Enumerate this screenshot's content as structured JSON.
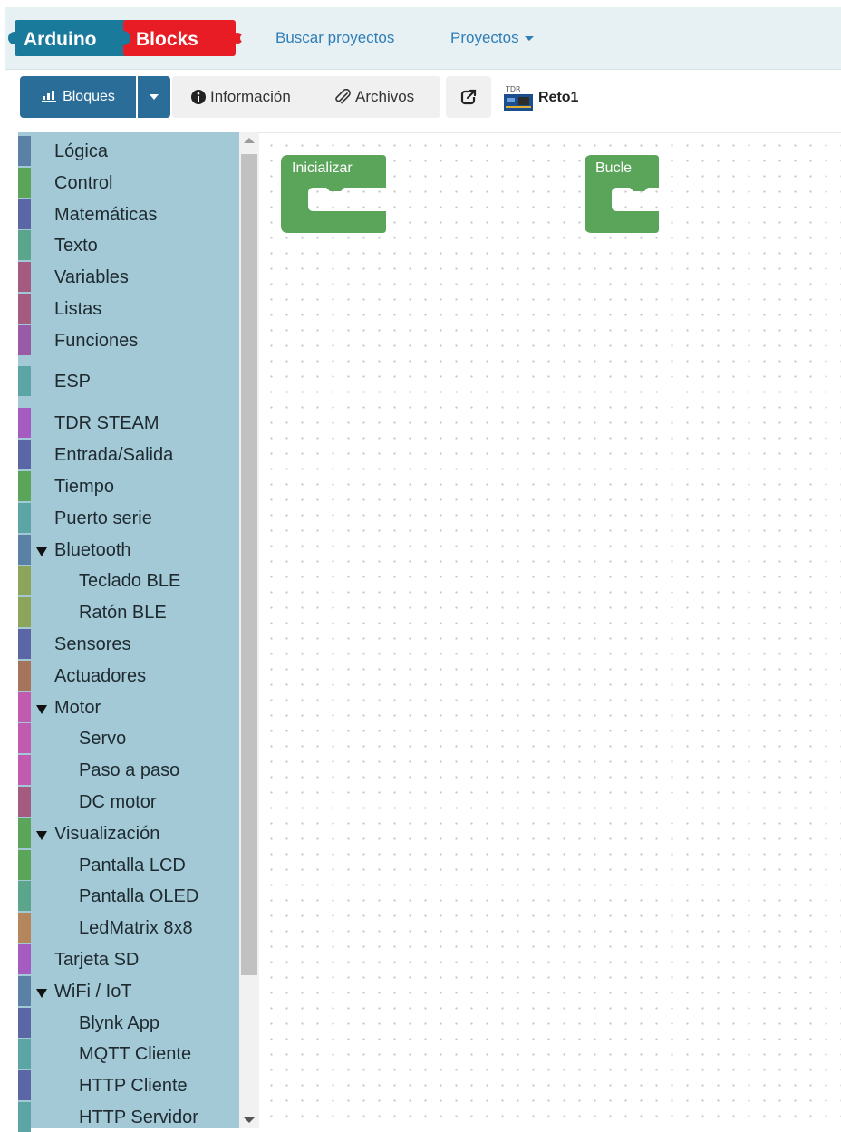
{
  "brand": {
    "part1": "Arduino",
    "part2": "Blocks",
    "color1": "#1a7a9c",
    "color2": "#e81c24"
  },
  "nav": {
    "search_label": "Buscar proyectos",
    "projects_label": "Proyectos"
  },
  "toolbar": {
    "bloques_label": "Bloques",
    "info_label": "Información",
    "files_label": "Archivos",
    "project_name": "Reto1"
  },
  "sidebar": {
    "categories": [
      {
        "label": "Lógica",
        "color": "#5b80a5",
        "level": 0
      },
      {
        "label": "Control",
        "color": "#5ba55b",
        "level": 0
      },
      {
        "label": "Matemáticas",
        "color": "#5b67a5",
        "level": 0
      },
      {
        "label": "Texto",
        "color": "#5ba58c",
        "level": 0
      },
      {
        "label": "Variables",
        "color": "#a55b80",
        "level": 0
      },
      {
        "label": "Listas",
        "color": "#a55b80",
        "level": 0
      },
      {
        "label": "Funciones",
        "color": "#995ba5",
        "level": 0
      },
      {
        "label": "ESP",
        "color": "#5ba5a5",
        "level": 0
      },
      {
        "label": "TDR STEAM",
        "color": "#a55bc0",
        "level": 0
      },
      {
        "label": "Entrada/Salida",
        "color": "#5b67a5",
        "level": 0
      },
      {
        "label": "Tiempo",
        "color": "#5ba55b",
        "level": 0
      },
      {
        "label": "Puerto serie",
        "color": "#5ba5a5",
        "level": 0
      },
      {
        "label": "Bluetooth",
        "color": "#5b80a5",
        "level": 0,
        "expanded": true
      },
      {
        "label": "Teclado BLE",
        "color": "#8ca55b",
        "level": 1
      },
      {
        "label": "Ratón BLE",
        "color": "#8ca55b",
        "level": 1
      },
      {
        "label": "Sensores",
        "color": "#5b67a5",
        "level": 0
      },
      {
        "label": "Actuadores",
        "color": "#a5745b",
        "level": 0
      },
      {
        "label": "Motor",
        "color": "#c05bb0",
        "level": 0,
        "expanded": true
      },
      {
        "label": "Servo",
        "color": "#c05bb0",
        "level": 1
      },
      {
        "label": "Paso a paso",
        "color": "#c05bb0",
        "level": 1
      },
      {
        "label": "DC motor",
        "color": "#a55b80",
        "level": 1
      },
      {
        "label": "Visualización",
        "color": "#5ba55b",
        "level": 0,
        "expanded": true
      },
      {
        "label": "Pantalla LCD",
        "color": "#5ba55b",
        "level": 1
      },
      {
        "label": "Pantalla OLED",
        "color": "#5ba58c",
        "level": 1
      },
      {
        "label": "LedMatrix 8x8",
        "color": "#b5865b",
        "level": 1
      },
      {
        "label": "Tarjeta SD",
        "color": "#a55bc0",
        "level": 0
      },
      {
        "label": "WiFi / IoT",
        "color": "#5b80a5",
        "level": 0,
        "expanded": true
      },
      {
        "label": "Blynk App",
        "color": "#5b67a5",
        "level": 1
      },
      {
        "label": "MQTT Cliente",
        "color": "#5ba5a5",
        "level": 1
      },
      {
        "label": "HTTP Cliente",
        "color": "#5b67a5",
        "level": 1
      },
      {
        "label": "HTTP Servidor",
        "color": "#5ba5a5",
        "level": 1
      }
    ]
  },
  "workspace": {
    "blocks": [
      {
        "label": "Inicializar",
        "color": "#5ba55b"
      },
      {
        "label": "Bucle",
        "color": "#5ba55b"
      }
    ]
  }
}
